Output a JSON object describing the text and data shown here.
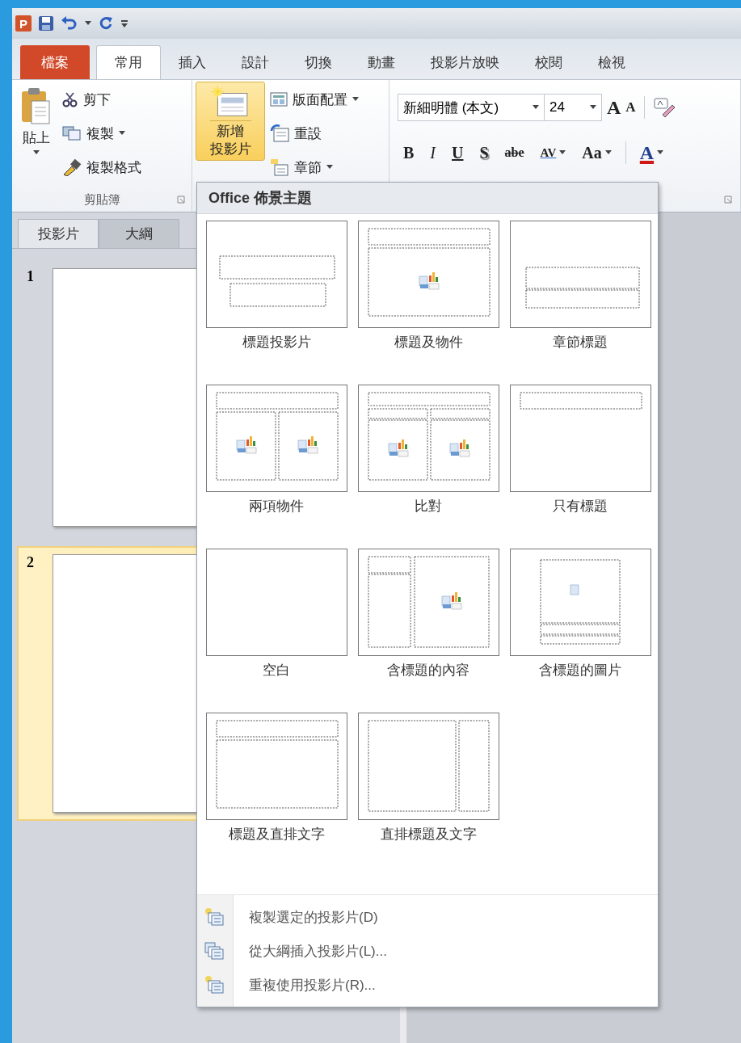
{
  "app_logo": "P",
  "ribbon_tabs": [
    {
      "label": "檔案",
      "kind": "file",
      "selected": false
    },
    {
      "label": "常用",
      "kind": "tab",
      "selected": true
    },
    {
      "label": "插入",
      "kind": "tab",
      "selected": false
    },
    {
      "label": "設計",
      "kind": "tab",
      "selected": false
    },
    {
      "label": "切換",
      "kind": "tab",
      "selected": false
    },
    {
      "label": "動畫",
      "kind": "tab",
      "selected": false
    },
    {
      "label": "投影片放映",
      "kind": "tab",
      "selected": false
    },
    {
      "label": "校閱",
      "kind": "tab",
      "selected": false
    },
    {
      "label": "檢視",
      "kind": "tab",
      "selected": false
    }
  ],
  "clipboard": {
    "paste": "貼上",
    "cut": "剪下",
    "copy": "複製",
    "format_painter": "複製格式",
    "group_label": "剪貼簿"
  },
  "slides_group": {
    "new_slide": {
      "lines": [
        "新增",
        "投影片"
      ],
      "selected": true
    },
    "layout": "版面配置",
    "reset": "重設",
    "section": "章節"
  },
  "font_group": {
    "font_name": "新細明體 (本文)",
    "font_size": "24",
    "size_buttons": [
      {
        "label": "A",
        "kind": "grow"
      },
      {
        "label": "A",
        "kind": "shrink"
      }
    ],
    "buttons": [
      {
        "label": "B",
        "kind": "bold"
      },
      {
        "label": "I",
        "kind": "italic"
      },
      {
        "label": "U",
        "kind": "underline"
      },
      {
        "label": "S",
        "kind": "shadow"
      },
      {
        "label": "abe",
        "kind": "strike"
      },
      {
        "label": "AV",
        "kind": "spacing"
      },
      {
        "label": "Aa",
        "kind": "case"
      },
      {
        "label": "A",
        "kind": "color"
      }
    ]
  },
  "slide_pane": {
    "tabs": [
      {
        "label": "投影片",
        "selected": true
      },
      {
        "label": "大綱",
        "selected": false
      }
    ],
    "slides": [
      {
        "number": "1",
        "selected": false
      },
      {
        "number": "2",
        "selected": true
      }
    ]
  },
  "layout_menu": {
    "title": "Office 佈景主題",
    "layouts": [
      {
        "label": "標題投影片",
        "kind": "title"
      },
      {
        "label": "標題及物件",
        "kind": "title-content"
      },
      {
        "label": "章節標題",
        "kind": "section"
      },
      {
        "label": "兩項物件",
        "kind": "two-content"
      },
      {
        "label": "比對",
        "kind": "comparison"
      },
      {
        "label": "只有標題",
        "kind": "title-only"
      },
      {
        "label": "空白",
        "kind": "blank"
      },
      {
        "label": "含標題的內容",
        "kind": "content-caption"
      },
      {
        "label": "含標題的圖片",
        "kind": "picture-caption"
      },
      {
        "label": "標題及直排文字",
        "kind": "title-vertical"
      },
      {
        "label": "直排標題及文字",
        "kind": "vertical-title"
      }
    ],
    "items": [
      {
        "label": "複製選定的投影片(D)",
        "kind": "duplicate"
      },
      {
        "label": "從大綱插入投影片(L)...",
        "kind": "outline"
      },
      {
        "label": "重複使用投影片(R)...",
        "kind": "reuse"
      }
    ]
  }
}
